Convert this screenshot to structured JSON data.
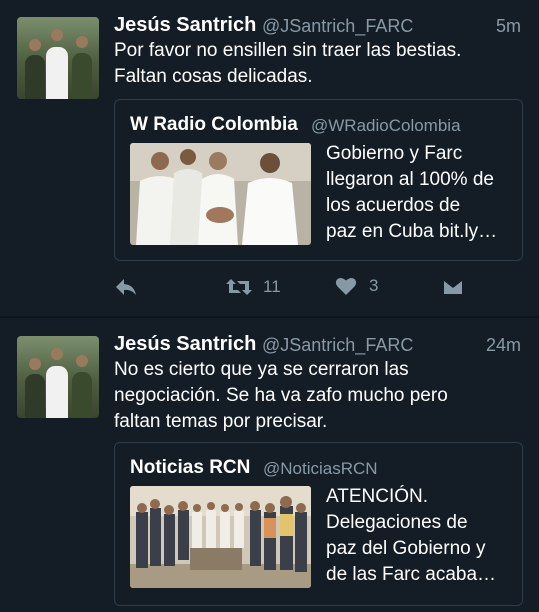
{
  "tweets": [
    {
      "author": "Jesús Santrich",
      "handle": "@JSantrich_FARC",
      "time": "5m",
      "lines": [
        "Por favor no ensillen sin traer las bestias.",
        "Faltan cosas delicadas."
      ],
      "card": {
        "name": "W Radio Colombia",
        "handle": "@WRadioColombia",
        "lines": [
          "Gobierno y Farc",
          "llegaron al 100% de",
          "los acuerdos de",
          "paz en Cuba bit.ly…"
        ]
      },
      "retweets": "11",
      "likes": "3"
    },
    {
      "author": "Jesús Santrich",
      "handle": "@JSantrich_FARC",
      "time": "24m",
      "lines": [
        "No es cierto que ya se cerraron las",
        "negociación. Se ha va zafo mucho pero",
        "faltan temas por precisar."
      ],
      "card": {
        "name": "Noticias RCN",
        "handle": "@NoticiasRCN",
        "lines": [
          "ATENCIÓN.",
          "Delegaciones de",
          "paz del Gobierno y",
          "de las Farc acaba…"
        ]
      }
    }
  ],
  "icons": {
    "reply": "reply-icon",
    "retweet": "retweet-icon",
    "like": "heart-icon",
    "dm": "envelope-icon"
  },
  "colors": {
    "background": "#141d26",
    "secondary_text": "#8899a6",
    "card_border": "#2c3c4b"
  }
}
